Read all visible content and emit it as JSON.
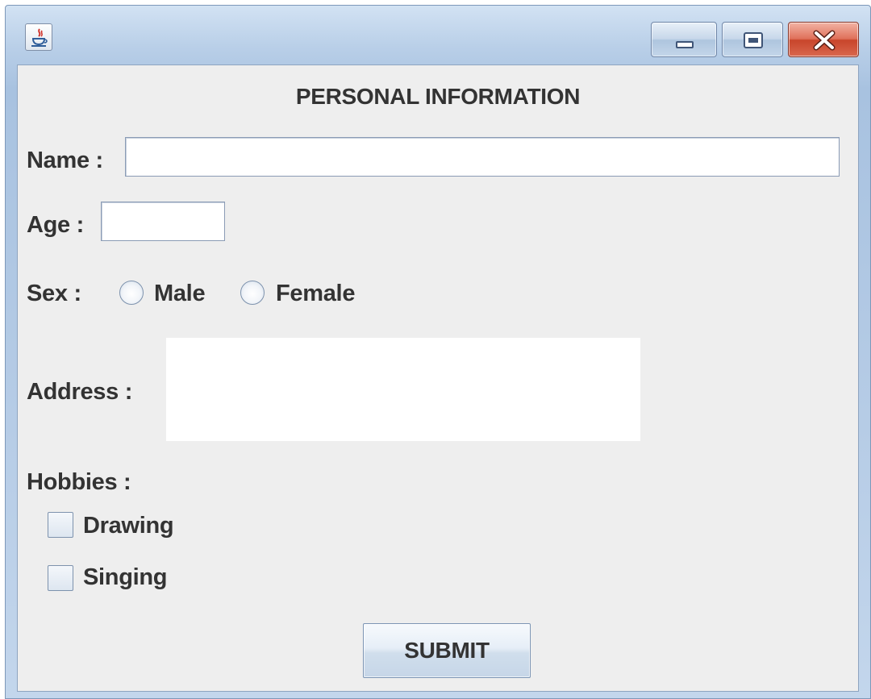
{
  "window": {
    "controls": [
      "minimize",
      "maximize",
      "close"
    ]
  },
  "form": {
    "title": "PERSONAL INFORMATION",
    "name_label": "Name :",
    "name_value": "",
    "age_label": "Age :",
    "age_value": "",
    "sex_label": "Sex :",
    "sex_options": [
      "Male",
      "Female"
    ],
    "address_label": "Address :",
    "address_value": "",
    "hobbies_label": "Hobbies :",
    "hobbies": [
      "Drawing",
      "Singing"
    ],
    "submit_label": "SUBMIT"
  },
  "icons": {
    "app": "java-coffee-icon",
    "minimize": "minimize-icon",
    "maximize": "maximize-icon",
    "close": "close-icon"
  },
  "colors": {
    "close_button": "#d0553a",
    "panel_bg": "#eeeeee",
    "text": "#333333"
  }
}
